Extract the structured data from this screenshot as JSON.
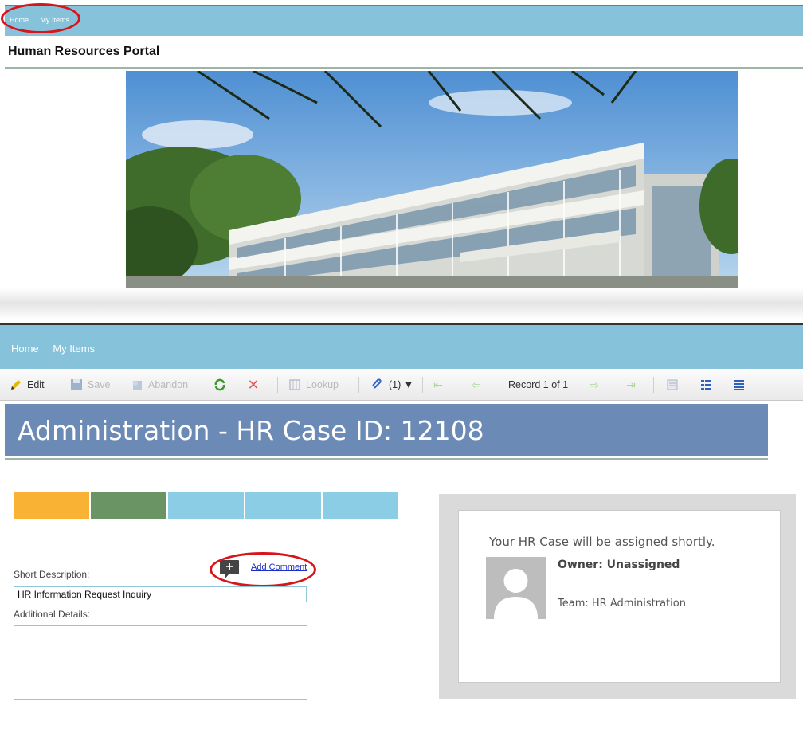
{
  "portal": {
    "nav": [
      "Home",
      "My Items"
    ],
    "title": "Human Resources Portal",
    "banner_alt": "Cragmor Hall building"
  },
  "case": {
    "nav": [
      "Home",
      "My Items"
    ],
    "toolbar": {
      "edit": "Edit",
      "save": "Save",
      "abandon": "Abandon",
      "lookup": "Lookup",
      "attachments": "(1) ▼",
      "record": "Record 1 of 1"
    },
    "title": "Administration - HR Case ID: 12108",
    "stage_colors": [
      "#f9b233",
      "#6b9464",
      "#8ccde6",
      "#8ccde6",
      "#8ccde6"
    ],
    "add_comment": "Add Comment",
    "short_description_label": "Short Description:",
    "short_description_value": "HR Information Request Inquiry",
    "additional_details_label": "Additional Details:",
    "assignment": {
      "message": "Your HR Case will be assigned shortly.",
      "owner": "Owner: Unassigned",
      "team": "Team: HR Administration"
    }
  },
  "icons": [
    "pencil-icon",
    "save-icon",
    "abandon-icon",
    "refresh-icon",
    "delete-icon",
    "lookup-icon",
    "paperclip-icon",
    "first-record-icon",
    "prev-record-icon",
    "next-record-icon",
    "last-record-icon",
    "form-view-icon",
    "list-view-icon",
    "detail-view-icon",
    "add-comment-icon",
    "avatar-icon"
  ]
}
